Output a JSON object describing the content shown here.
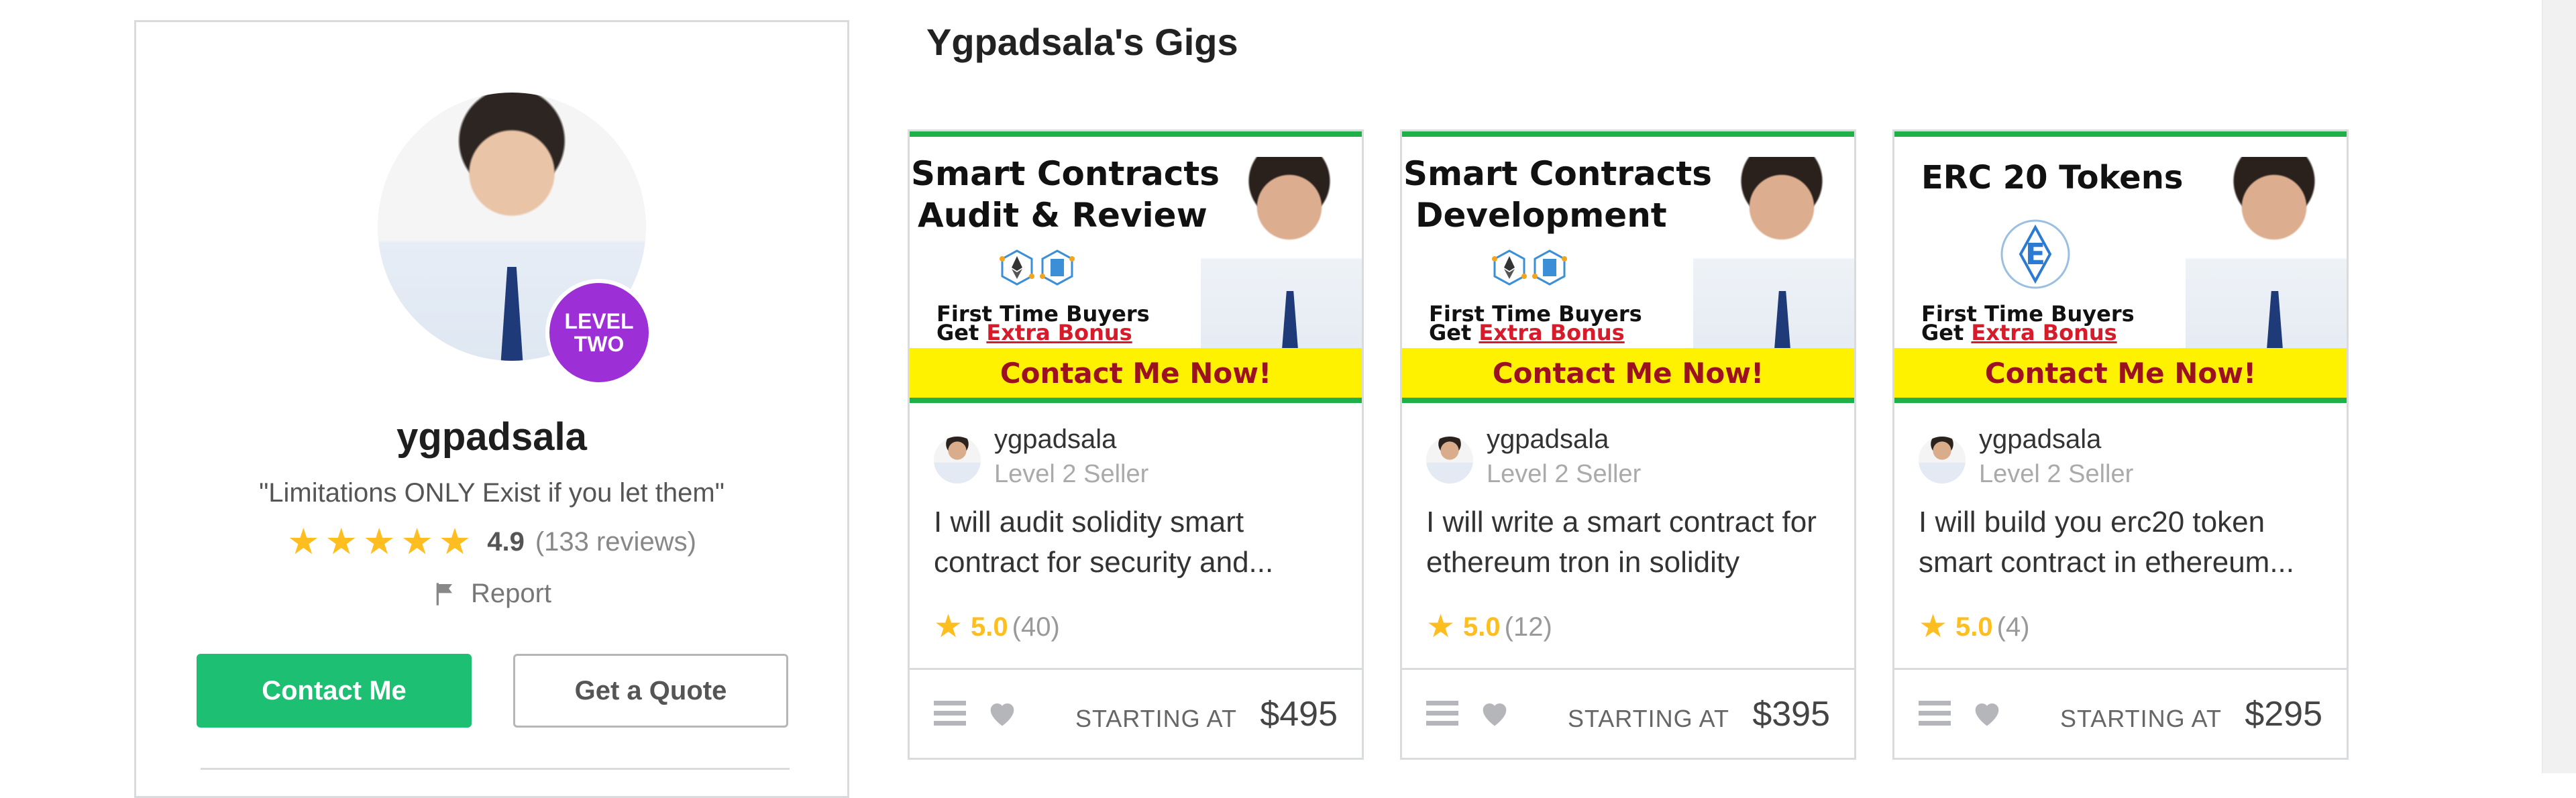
{
  "profile": {
    "level_line1": "LEVEL",
    "level_line2": "TWO",
    "username": "ygpadsala",
    "tagline": "\"Limitations ONLY Exist if you let them\"",
    "rating_score": "4.9",
    "rating_count": "(133 reviews)",
    "report_label": "Report",
    "contact_label": "Contact Me",
    "quote_label": "Get a Quote"
  },
  "section_title": "Ygpadsala's Gigs",
  "gigs": [
    {
      "thumb_title_1": "Smart Contracts",
      "thumb_title_2": "Audit & Review",
      "thumb_buyers_1": "First Time Buyers",
      "thumb_buyers_2": "Get",
      "thumb_bonus": "Extra Bonus",
      "thumb_banner": "Contact Me Now!",
      "seller_name": "ygpadsala",
      "seller_level": "Level 2 Seller",
      "description": "I will audit solidity smart contract for security and...",
      "rating": "5.0",
      "rating_count": "(40)",
      "starting_at": "STARTING AT",
      "price": "$495"
    },
    {
      "thumb_title_1": "Smart Contracts",
      "thumb_title_2": "Development",
      "thumb_buyers_1": "First Time Buyers",
      "thumb_buyers_2": "Get",
      "thumb_bonus": "Extra Bonus",
      "thumb_banner": "Contact Me Now!",
      "seller_name": "ygpadsala",
      "seller_level": "Level 2 Seller",
      "description": "I will write a smart contract for ethereum tron in solidity",
      "rating": "5.0",
      "rating_count": "(12)",
      "starting_at": "STARTING AT",
      "price": "$395"
    },
    {
      "thumb_title_1": "ERC 20 Tokens",
      "thumb_title_2": "",
      "thumb_buyers_1": "First Time Buyers",
      "thumb_buyers_2": "Get",
      "thumb_bonus": "Extra Bonus",
      "thumb_banner": "Contact Me Now!",
      "seller_name": "ygpadsala",
      "seller_level": "Level 2 Seller",
      "description": "I will build you erc20 token smart contract in ethereum...",
      "rating": "5.0",
      "rating_count": "(4)",
      "starting_at": "STARTING AT",
      "price": "$295"
    }
  ],
  "colors": {
    "accent_green": "#1dbf73",
    "star_yellow": "#ffbe1f",
    "level_badge_purple": "#9c2fd6",
    "banner_yellow": "#fff200",
    "banner_text": "#9b1120"
  },
  "icons": [
    "star-icon",
    "flag-icon",
    "menu-icon",
    "heart-icon"
  ]
}
